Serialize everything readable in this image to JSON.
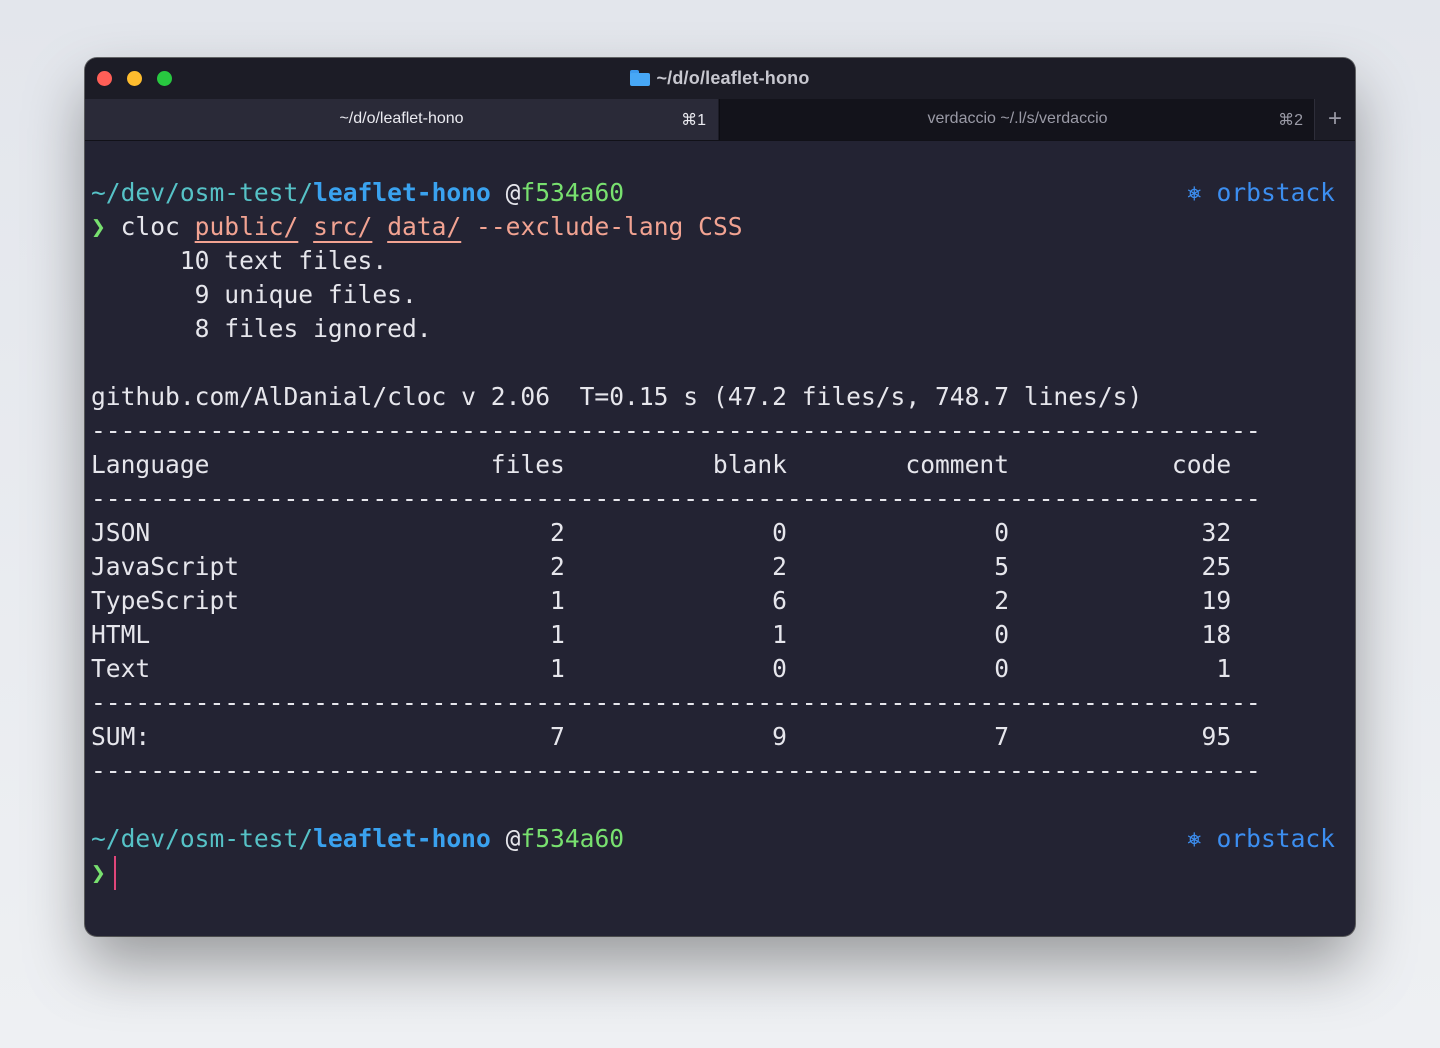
{
  "window": {
    "title": "~/d/o/leaflet-hono"
  },
  "tabs": [
    {
      "label": "~/d/o/leaflet-hono",
      "shortcut": "⌘1"
    },
    {
      "label": "verdaccio  ~/.l/s/verdaccio",
      "shortcut": "⌘2"
    }
  ],
  "new_tab_label": "+",
  "prompt": {
    "path_prefix": "~/dev/osm-test/",
    "dir": "leaflet-hono",
    "at": "@",
    "hash": "f534a60",
    "context_icon": "kubernetes-icon",
    "context_glyph": "⎈",
    "context": "orbstack",
    "symbol": "❯"
  },
  "command": {
    "name": "cloc",
    "args": [
      "public/",
      "src/",
      "data/"
    ],
    "flag": "--exclude-lang CSS"
  },
  "output": {
    "summary": [
      "      10 text files.",
      "       9 unique files.",
      "       8 files ignored."
    ],
    "header_line": "github.com/AlDanial/cloc v 2.06  T=0.15 s (47.2 files/s, 748.7 lines/s)",
    "separator": "-------------------------------------------------------------------------------",
    "columns": [
      "Language",
      "files",
      "blank",
      "comment",
      "code"
    ],
    "rows": [
      [
        "JSON",
        "2",
        "0",
        "0",
        "32"
      ],
      [
        "JavaScript",
        "2",
        "2",
        "5",
        "25"
      ],
      [
        "TypeScript",
        "1",
        "6",
        "2",
        "19"
      ],
      [
        "HTML",
        "1",
        "1",
        "0",
        "18"
      ],
      [
        "Text",
        "1",
        "0",
        "0",
        "1"
      ]
    ],
    "sum": [
      "SUM:",
      "7",
      "9",
      "7",
      "95"
    ]
  },
  "colors": {
    "background": "#232333",
    "path": "#56c2c7",
    "dir": "#3aa2ef",
    "hash": "#78e06f",
    "arg": "#f2a392",
    "context": "#3c8ef0",
    "cursor": "#e0467a"
  }
}
